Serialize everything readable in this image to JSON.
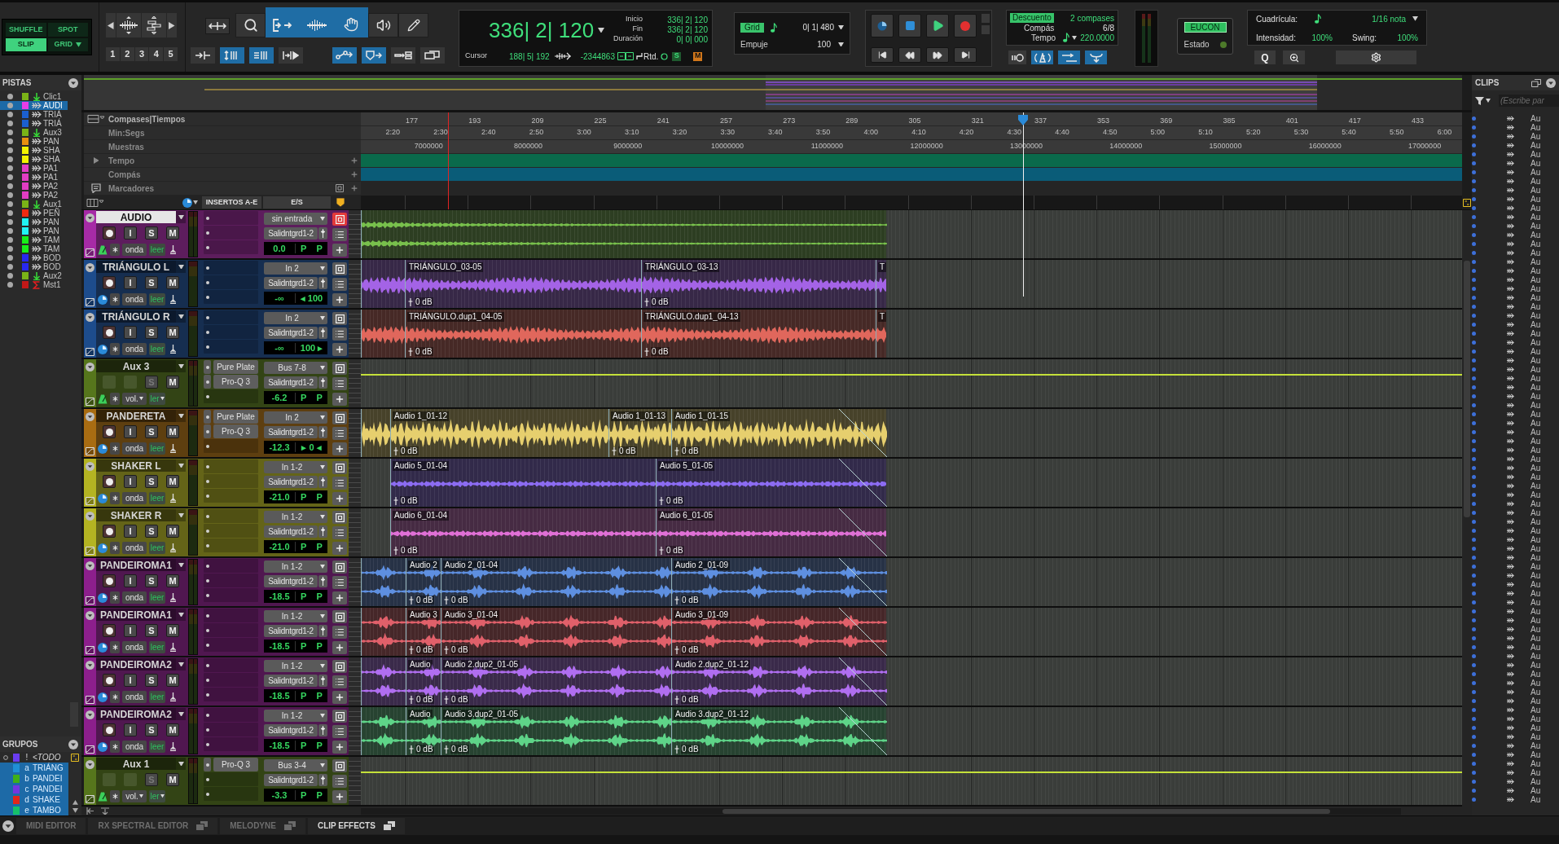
{
  "toolbar": {
    "edit_modes": [
      {
        "label": "SHUFFLE",
        "selected": false
      },
      {
        "label": "SPOT",
        "selected": false
      },
      {
        "label": "SLIP",
        "selected": true
      },
      {
        "label": "GRID",
        "selected": false,
        "dropdown": true
      }
    ],
    "zoom_presets": [
      "1",
      "2",
      "3",
      "4",
      "5"
    ],
    "tools": [
      {
        "kind": "zoom",
        "selected": false
      },
      {
        "kind": "trim",
        "selected": true
      },
      {
        "kind": "selector",
        "selected": true
      },
      {
        "kind": "grabber",
        "selected": true
      },
      {
        "kind": "scrub",
        "selected": false
      },
      {
        "kind": "pencil",
        "selected": false
      }
    ],
    "toggles": [
      {
        "kind": "split",
        "on": false
      },
      {
        "kind": "updown",
        "on": true
      },
      {
        "kind": "lines",
        "on": true
      },
      {
        "kind": "bracket",
        "on": false
      },
      {
        "kind": "nodes",
        "on": true
      },
      {
        "kind": "shield",
        "on": true
      },
      {
        "kind": "boxes",
        "on": false
      },
      {
        "kind": "windows",
        "on": false
      }
    ],
    "counter": {
      "main": "336| 2| 120",
      "rows": [
        {
          "label": "Inicio",
          "value": "336| 2| 120"
        },
        {
          "label": "Fin",
          "value": "336| 2| 120"
        },
        {
          "label": "Duración",
          "value": "0| 0| 000"
        }
      ],
      "cursor_label": "Cursor",
      "cursor": "188| 5| 192",
      "sample": "-2344863",
      "delay_label": "Rtd.",
      "s_flag": "S",
      "m_flag": "M"
    },
    "grid": {
      "label": "Grid",
      "value": "0| 1| 480",
      "nudge_label": "Empuje",
      "nudge": "100"
    },
    "tempo": {
      "countoff": "Descuento",
      "countoff_value": "2 compases",
      "meter_label": "Compás",
      "meter": "6/8",
      "tempo_label": "Tempo",
      "tempo": "220.0000",
      "toggles": [
        {
          "kind": "pause",
          "on": false
        },
        {
          "kind": "metronome",
          "on": true
        },
        {
          "kind": "arrow",
          "on": true
        },
        {
          "kind": "fork",
          "on": true
        }
      ]
    },
    "eucon": {
      "label": "EUCON",
      "status_label": "Estado"
    },
    "quantize": {
      "grid_label": "Cuadrícula:",
      "grid_value": "1/16 nota",
      "strength_label": "Intensidad:",
      "strength": "100%",
      "swing_label": "Swing:",
      "swing": "100%",
      "button": "Q"
    }
  },
  "tracks_panel": {
    "title": "PISTAS",
    "items": [
      {
        "name": "Clic1",
        "kind": "aux",
        "color": "#7ab317",
        "selected": false
      },
      {
        "name": "AUDI",
        "kind": "audio",
        "color": "#e83ce8",
        "selected": true
      },
      {
        "name": "TRIÁ",
        "kind": "audio",
        "color": "#1b5fcf",
        "selected": false
      },
      {
        "name": "TRIÁ",
        "kind": "audio",
        "color": "#1b5fcf",
        "selected": false
      },
      {
        "name": "Aux3",
        "kind": "aux",
        "color": "#7ab317",
        "selected": false
      },
      {
        "name": "PAN",
        "kind": "audio",
        "color": "#e8900f",
        "selected": false
      },
      {
        "name": "SHA",
        "kind": "audio",
        "color": "#f2f200",
        "selected": false
      },
      {
        "name": "SHA",
        "kind": "audio",
        "color": "#f2f200",
        "selected": false
      },
      {
        "name": "PA1",
        "kind": "audio",
        "color": "#e23cc4",
        "selected": false
      },
      {
        "name": "PA1",
        "kind": "audio",
        "color": "#e23cc4",
        "selected": false
      },
      {
        "name": "PA2",
        "kind": "audio",
        "color": "#e23cc4",
        "selected": false
      },
      {
        "name": "PA2",
        "kind": "audio",
        "color": "#e23cc4",
        "selected": false
      },
      {
        "name": "Aux1",
        "kind": "aux",
        "color": "#7ab317",
        "selected": false
      },
      {
        "name": "PEÑ",
        "kind": "audio",
        "color": "#f02a10",
        "selected": false
      },
      {
        "name": "PAN",
        "kind": "audio",
        "color": "#20f2f2",
        "selected": false
      },
      {
        "name": "PAN",
        "kind": "audio",
        "color": "#20f2f2",
        "selected": false
      },
      {
        "name": "TAM",
        "kind": "audio",
        "color": "#18ee18",
        "selected": false
      },
      {
        "name": "TAM",
        "kind": "audio",
        "color": "#18ee18",
        "selected": false
      },
      {
        "name": "BOD",
        "kind": "audio",
        "color": "#2828f0",
        "selected": false
      },
      {
        "name": "BOD",
        "kind": "audio",
        "color": "#2828f0",
        "selected": false
      },
      {
        "name": "Aux2",
        "kind": "aux",
        "color": "#7ab317",
        "selected": false
      },
      {
        "name": "Mst1",
        "kind": "master",
        "color": "#c21818",
        "selected": false
      }
    ]
  },
  "groups_panel": {
    "title": "GRUPOS",
    "items": [
      {
        "id": "!",
        "name": "<TODO",
        "kind": "all",
        "color": "#6a3cf0",
        "selected": false
      },
      {
        "id": "a",
        "name": "TRIÁNG",
        "kind": "group",
        "color": "#1f8fd6",
        "selected": true
      },
      {
        "id": "b",
        "name": "PANDEI",
        "kind": "group",
        "color": "#3fb017",
        "selected": true
      },
      {
        "id": "c",
        "name": "PANDEI",
        "kind": "group",
        "color": "#7336e0",
        "selected": true
      },
      {
        "id": "d",
        "name": "SHAKE",
        "kind": "group",
        "color": "#e4261a",
        "selected": true
      },
      {
        "id": "e",
        "name": "TAMBO",
        "kind": "group",
        "color": "#16c06a",
        "selected": true
      }
    ]
  },
  "rulers": [
    {
      "kind": "bars",
      "label": "Compases|Tiempos",
      "ticks": [
        "177",
        "193",
        "209",
        "225",
        "241",
        "257",
        "273",
        "289",
        "305",
        "321",
        "337",
        "353",
        "369",
        "385",
        "401",
        "417",
        "433"
      ]
    },
    {
      "kind": "minsecs",
      "label": "Min:Segs",
      "ticks": [
        "2:20",
        "2:30",
        "2:40",
        "2:50",
        "3:00",
        "3:10",
        "3:20",
        "3:30",
        "3:40",
        "3:50",
        "4:00",
        "4:10",
        "4:20",
        "4:30",
        "4:40",
        "4:50",
        "5:00",
        "5:10",
        "5:20",
        "5:30",
        "5:40",
        "5:50",
        "6:00"
      ]
    },
    {
      "kind": "samples",
      "label": "Muestras",
      "ticks": [
        "7000000",
        "8000000",
        "9000000",
        "10000000",
        "11000000",
        "12000000",
        "13000000",
        "14000000",
        "15000000",
        "16000000",
        "17000000"
      ]
    },
    {
      "kind": "tempo",
      "label": "Tempo",
      "expanded": false
    },
    {
      "kind": "meter",
      "label": "Compás"
    },
    {
      "kind": "markers",
      "label": "Marcadores"
    }
  ],
  "column_header": {
    "inserts": "INSERTOS A-E",
    "io": "E/S"
  },
  "tracks": [
    {
      "name": "AUDIO",
      "kind": "audio",
      "color": "#a62ba6",
      "selected": true,
      "stereo": true,
      "tick_based": true,
      "buttons": [
        {
          "label": "I",
          "disabled": false
        },
        {
          "label": "S",
          "disabled": false
        },
        {
          "label": "M",
          "disabled": false
        }
      ],
      "view": "onda",
      "automation": "leer",
      "input": "sin entrada",
      "input_alert": true,
      "output": "Salidntgrd1-2",
      "volume": "0.0",
      "pan": [
        "P",
        "P"
      ],
      "clips": [
        {
          "kind": "fragment",
          "color": "#78c04c"
        }
      ]
    },
    {
      "name": "TRIÁNGULO L",
      "kind": "audio",
      "color": "#1d4c8c",
      "selected": false,
      "stereo": false,
      "tick_based": false,
      "buttons": [
        {
          "label": "I",
          "disabled": false
        },
        {
          "label": "S",
          "disabled": false
        },
        {
          "label": "M",
          "disabled": false
        }
      ],
      "view": "onda",
      "automation": "leer",
      "input": "In 2",
      "input_alert": false,
      "output": "Salidntgrd1-2",
      "volume": "-∞",
      "pan": [
        "◂ 100"
      ],
      "clips": [
        {
          "kind": "fragment",
          "color": "#a463e6"
        },
        {
          "kind": "region",
          "name": "TRIÁNGULO_03-05",
          "gain": "0 dB",
          "color": "#a463e6"
        },
        {
          "kind": "region",
          "name": "TRIÁNGULO_03-13",
          "gain": "0 dB",
          "color": "#a463e6"
        },
        {
          "kind": "region",
          "name": "T",
          "color": "#a463e6"
        }
      ]
    },
    {
      "name": "TRIÁNGULO R",
      "kind": "audio",
      "color": "#1d4c8c",
      "selected": false,
      "stereo": false,
      "tick_based": false,
      "buttons": [
        {
          "label": "I",
          "disabled": false
        },
        {
          "label": "S",
          "disabled": false
        },
        {
          "label": "M",
          "disabled": false
        }
      ],
      "view": "onda",
      "automation": "leer",
      "input": "In 2",
      "input_alert": false,
      "output": "Salidntgrd1-2",
      "volume": "-∞",
      "pan": [
        "100 ▸"
      ],
      "clips": [
        {
          "kind": "fragment",
          "color": "#e0675c"
        },
        {
          "kind": "region",
          "name": "TRIÁNGULO.dup1_04-05",
          "gain": "0 dB",
          "color": "#e0675c"
        },
        {
          "kind": "region",
          "name": "TRIÁNGULO.dup1_04-13",
          "gain": "0 dB",
          "color": "#e0675c"
        },
        {
          "kind": "region",
          "name": "T",
          "color": "#e0675c"
        }
      ]
    },
    {
      "name": "Aux 3",
      "kind": "aux",
      "color": "#56761c",
      "selected": false,
      "stereo": true,
      "tick_based": true,
      "buttons": [
        {
          "label": "S",
          "disabled": true
        },
        {
          "label": "M",
          "disabled": false
        }
      ],
      "view": "vol.",
      "automation": "ler",
      "inserts": [
        "Pure Plate",
        "Pro-Q 3"
      ],
      "input": "Bus 7-8",
      "input_alert": false,
      "output": "Salidntgrd1-2",
      "volume": "-6.2",
      "pan": [
        "P",
        "P"
      ]
    },
    {
      "name": "PANDERETA",
      "kind": "audio",
      "color": "#a86c12",
      "selected": false,
      "stereo": false,
      "tick_based": false,
      "buttons": [
        {
          "label": "I",
          "disabled": false
        },
        {
          "label": "S",
          "disabled": false
        },
        {
          "label": "M",
          "disabled": false
        }
      ],
      "view": "onda",
      "automation": "leer",
      "inserts": [
        "Pure Plate",
        "Pro-Q 3"
      ],
      "input": "In 2",
      "input_alert": false,
      "output": "Salidntgrd1-2",
      "volume": "-12.3",
      "pan": [
        "▸ 0 ◂"
      ],
      "clips": [
        {
          "kind": "fragment",
          "color": "#e6cf6e"
        },
        {
          "kind": "region",
          "name": "Audio 1_01-12",
          "gain": "0 dB",
          "color": "#e6cf6e"
        },
        {
          "kind": "region",
          "name": "Audio 1_01-13",
          "gain": "0 dB",
          "color": "#e6cf6e"
        },
        {
          "kind": "region",
          "name": "Audio 1_01-15",
          "gain": "0 dB",
          "color": "#e6cf6e",
          "fade_out": true
        }
      ]
    },
    {
      "name": "SHAKER L",
      "kind": "audio",
      "color": "#b4b422",
      "selected": false,
      "stereo": false,
      "tick_based": false,
      "buttons": [
        {
          "label": "I",
          "disabled": false
        },
        {
          "label": "S",
          "disabled": false
        },
        {
          "label": "M",
          "disabled": false
        }
      ],
      "view": "onda",
      "automation": "leer",
      "input": "In 1-2",
      "input_alert": false,
      "output": "Salidntgrd1-2",
      "volume": "-21.0",
      "pan": [
        "P",
        "P"
      ],
      "clips": [
        {
          "kind": "region",
          "name": "Audio 5_01-04",
          "gain": "0 dB",
          "color": "#8c6cf2"
        },
        {
          "kind": "region",
          "name": "Audio 5_01-05",
          "gain": "0 dB",
          "color": "#8c6cf2",
          "fade_out": true
        }
      ]
    },
    {
      "name": "SHAKER R",
      "kind": "audio",
      "color": "#b4b422",
      "selected": false,
      "stereo": false,
      "tick_based": false,
      "buttons": [
        {
          "label": "I",
          "disabled": false
        },
        {
          "label": "S",
          "disabled": false
        },
        {
          "label": "M",
          "disabled": false
        }
      ],
      "view": "onda",
      "automation": "leer",
      "input": "In 1-2",
      "input_alert": false,
      "output": "Salidntgrd1-2",
      "volume": "-21.0",
      "pan": [
        "P",
        "P"
      ],
      "clips": [
        {
          "kind": "region",
          "name": "Audio 6_01-04",
          "gain": "0 dB",
          "color": "#e070d6"
        },
        {
          "kind": "region",
          "name": "Audio 6_01-05",
          "gain": "0 dB",
          "color": "#e070d6",
          "fade_out": true
        }
      ]
    },
    {
      "name": "PANDEIROMA1",
      "kind": "audio",
      "color": "#8c1f8c",
      "selected": false,
      "stereo": true,
      "tick_based": false,
      "buttons": [
        {
          "label": "I",
          "disabled": false
        },
        {
          "label": "S",
          "disabled": false
        },
        {
          "label": "M",
          "disabled": false
        }
      ],
      "view": "onda",
      "automation": "leer",
      "input": "In 1-2",
      "input_alert": false,
      "output": "Salidntgrd1-2",
      "volume": "-18.5",
      "pan": [
        "P",
        "P"
      ],
      "clips": [
        {
          "kind": "fragment",
          "color": "#5e8fe0"
        },
        {
          "kind": "region",
          "name": "Audio 2",
          "gain": "0 dB",
          "color": "#5e8fe0"
        },
        {
          "kind": "region",
          "name": "Audio 2_01-04",
          "gain": "0 dB",
          "color": "#5e8fe0"
        },
        {
          "kind": "region",
          "name": "Audio 2_01-09",
          "gain": "0 dB",
          "color": "#5e8fe0",
          "fade_out": true
        }
      ]
    },
    {
      "name": "PANDEIROMA1",
      "kind": "audio",
      "color": "#8c1f8c",
      "selected": false,
      "stereo": true,
      "tick_based": false,
      "buttons": [
        {
          "label": "I",
          "disabled": false
        },
        {
          "label": "S",
          "disabled": false
        },
        {
          "label": "M",
          "disabled": false
        }
      ],
      "view": "onda",
      "automation": "leer",
      "input": "In 1-2",
      "input_alert": false,
      "output": "Salidntgrd1-2",
      "volume": "-18.5",
      "pan": [
        "P",
        "P"
      ],
      "clips": [
        {
          "kind": "fragment",
          "color": "#e0606a"
        },
        {
          "kind": "region",
          "name": "Audio 3",
          "gain": "0 dB",
          "color": "#e0606a"
        },
        {
          "kind": "region",
          "name": "Audio 3_01-04",
          "gain": "0 dB",
          "color": "#e0606a"
        },
        {
          "kind": "region",
          "name": "Audio 3_01-09",
          "gain": "0 dB",
          "color": "#e0606a",
          "fade_out": true
        }
      ]
    },
    {
      "name": "PANDEIROMA2",
      "kind": "audio",
      "color": "#8c1f8c",
      "selected": false,
      "stereo": true,
      "tick_based": false,
      "buttons": [
        {
          "label": "I",
          "disabled": false
        },
        {
          "label": "S",
          "disabled": false
        },
        {
          "label": "M",
          "disabled": false
        }
      ],
      "view": "onda",
      "automation": "leer",
      "input": "In 1-2",
      "input_alert": false,
      "output": "Salidntgrd1-2",
      "volume": "-18.5",
      "pan": [
        "P",
        "P"
      ],
      "clips": [
        {
          "kind": "fragment",
          "color": "#b06ef0"
        },
        {
          "kind": "region",
          "name": "Audio",
          "gain": "0 dB",
          "color": "#b06ef0"
        },
        {
          "kind": "region",
          "name": "Audio 2.dup2_01-05",
          "gain": "0 dB",
          "color": "#b06ef0"
        },
        {
          "kind": "region",
          "name": "Audio 2.dup2_01-12",
          "gain": "0 dB",
          "color": "#b06ef0",
          "fade_out": true
        }
      ]
    },
    {
      "name": "PANDEIROMA2",
      "kind": "audio",
      "color": "#8c1f8c",
      "selected": false,
      "stereo": true,
      "tick_based": false,
      "buttons": [
        {
          "label": "I",
          "disabled": false
        },
        {
          "label": "S",
          "disabled": false
        },
        {
          "label": "M",
          "disabled": false
        }
      ],
      "view": "onda",
      "automation": "leer",
      "input": "In 1-2",
      "input_alert": false,
      "output": "Salidntgrd1-2",
      "volume": "-18.5",
      "pan": [
        "P",
        "P"
      ],
      "clips": [
        {
          "kind": "fragment",
          "color": "#5ed488"
        },
        {
          "kind": "region",
          "name": "Audio",
          "gain": "0 dB",
          "color": "#5ed488"
        },
        {
          "kind": "region",
          "name": "Audio 3.dup2_01-05",
          "gain": "0 dB",
          "color": "#5ed488"
        },
        {
          "kind": "region",
          "name": "Audio 3.dup2_01-12",
          "gain": "0 dB",
          "color": "#5ed488",
          "fade_out": true
        }
      ]
    },
    {
      "name": "Aux 1",
      "kind": "aux",
      "color": "#56761c",
      "selected": false,
      "stereo": true,
      "tick_based": true,
      "buttons": [
        {
          "label": "S",
          "disabled": true
        },
        {
          "label": "M",
          "disabled": false
        }
      ],
      "view": "vol.",
      "automation": "ler",
      "inserts": [
        "Pro-Q 3"
      ],
      "input": "Bus 3-4",
      "input_alert": false,
      "output": "Salidntgrd1-2",
      "volume": "-3.3",
      "pan": [
        "P",
        "P"
      ]
    }
  ],
  "clips_panel": {
    "title": "CLIPS",
    "search": {
      "placeholder": "(Escribe par"
    },
    "items": [
      "Au",
      "Au",
      "Au",
      "Au",
      "Au",
      "Au",
      "Au",
      "Au",
      "Au",
      "Au",
      "Au",
      "Au",
      "Au",
      "Au",
      "Au",
      "Au",
      "Au",
      "Au",
      "Au",
      "Au",
      "Au",
      "Au",
      "Au",
      "Au",
      "Au",
      "Au",
      "Au",
      "Au",
      "Au",
      "Au",
      "Au",
      "Au",
      "Au",
      "Au",
      "Au",
      "Au",
      "Au",
      "Au",
      "Au",
      "Au",
      "Au",
      "Au",
      "Au",
      "Au",
      "Au",
      "Au",
      "Au",
      "Au",
      "Au",
      "Au",
      "Au",
      "Au",
      "Au",
      "Au",
      "Au",
      "Au",
      "Au",
      "Au",
      "Au",
      "Au",
      "Au",
      "Au",
      "Au",
      "Au",
      "Au",
      "Au",
      "Au",
      "Au",
      "Au",
      "Au",
      "Au",
      "Au",
      "Au",
      "Au",
      "Au",
      "Au",
      "Au"
    ]
  },
  "bottom_tabs": [
    {
      "label": "MIDI EDITOR",
      "selected": false,
      "detachable": false
    },
    {
      "label": "RX SPECTRAL EDITOR",
      "selected": false,
      "detachable": true
    },
    {
      "label": "MELODYNE",
      "selected": false,
      "detachable": true
    },
    {
      "label": "CLIP EFFECTS",
      "selected": true,
      "detachable": true
    }
  ]
}
